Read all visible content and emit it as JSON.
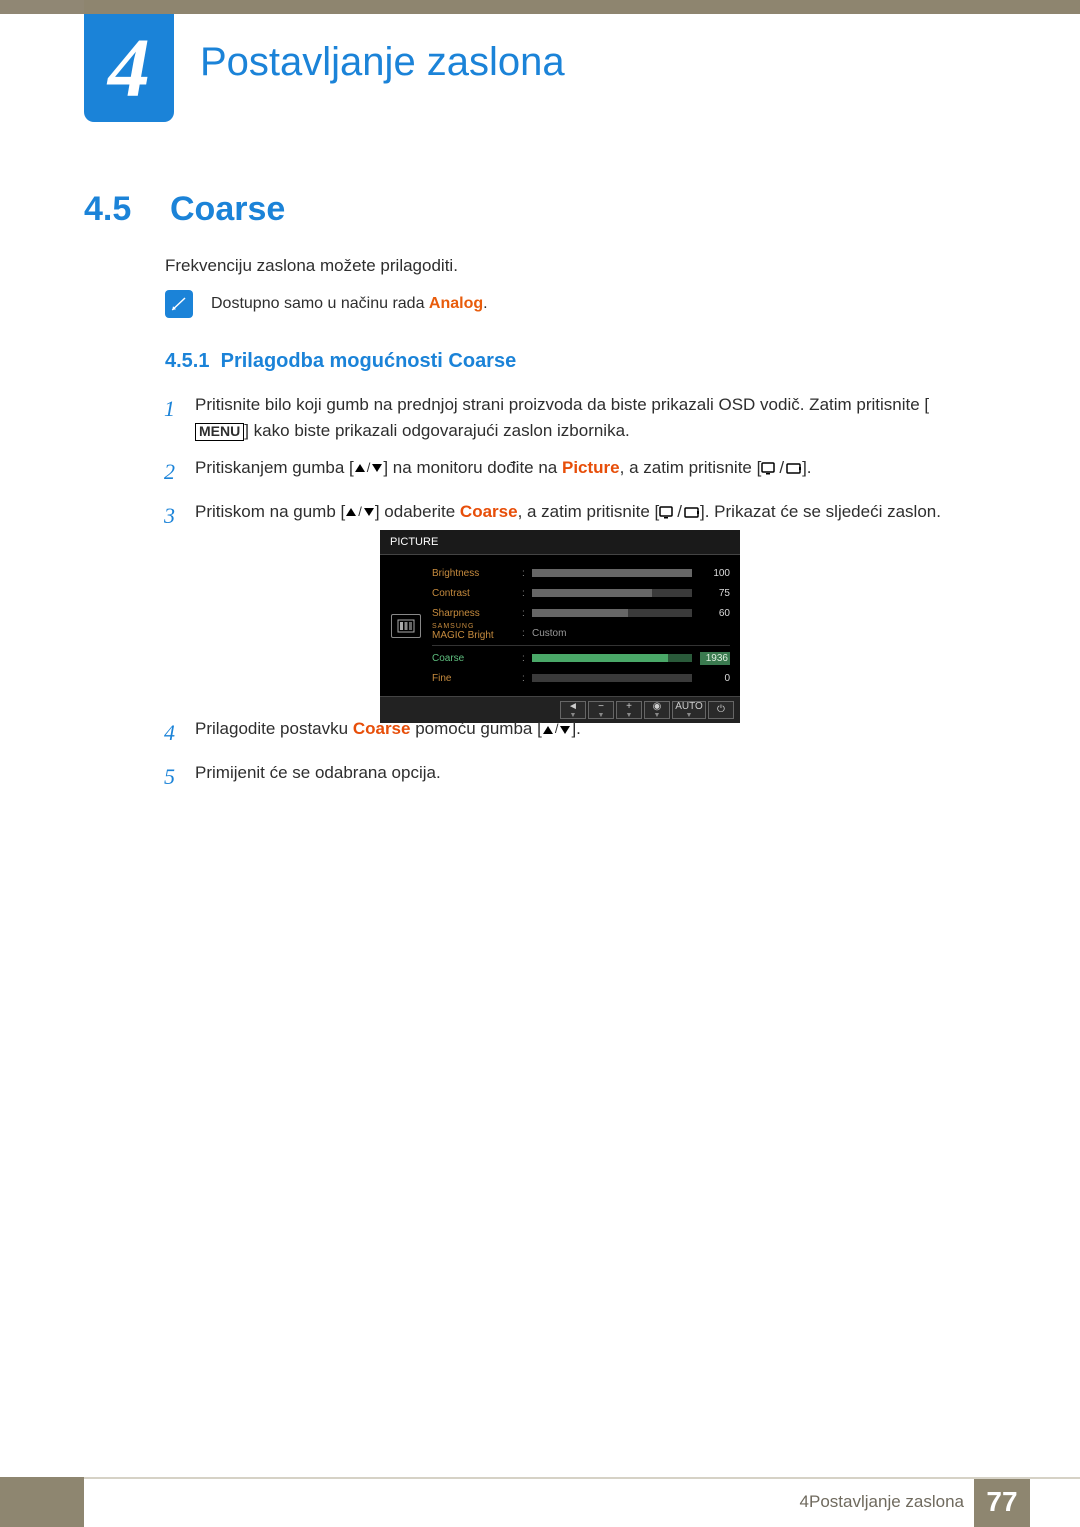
{
  "chapter": {
    "number": "4",
    "title": "Postavljanje zaslona"
  },
  "section": {
    "number": "4.5",
    "title": "Coarse"
  },
  "intro": "Frekvenciju zaslona možete prilagoditi.",
  "note": {
    "pre": "Dostupno samo u načinu rada ",
    "analog": "Analog",
    "post": "."
  },
  "subsection": {
    "number": "4.5.1",
    "title": "Prilagodba mogućnosti Coarse"
  },
  "steps": {
    "s1": {
      "num": "1",
      "a": "Pritisnite bilo koji gumb na prednjoj strani proizvoda da biste prikazali OSD vodič. Zatim pritisnite [",
      "menu": "MENU",
      "b": "] kako biste prikazali odgovarajući zaslon izbornika."
    },
    "s2": {
      "num": "2",
      "a": "Pritiskanjem gumba [",
      "b": "] na monitoru dođite na ",
      "picture": "Picture",
      "c": ", a zatim pritisnite [",
      "d": "]."
    },
    "s3": {
      "num": "3",
      "a": "Pritiskom na gumb [",
      "b": "] odaberite ",
      "coarse": "Coarse",
      "c": ", a zatim pritisnite [",
      "d": "]. Prikazat će se sljedeći zaslon."
    },
    "s4": {
      "num": "4",
      "a": "Prilagodite postavku ",
      "coarse": "Coarse",
      "b": " pomoću gumba [",
      "c": "]."
    },
    "s5": {
      "num": "5",
      "a": "Primijenit će se odabrana opcija."
    }
  },
  "osd": {
    "title": "PICTURE",
    "rows": {
      "brightness": {
        "label": "Brightness",
        "value": "100",
        "pct": 100
      },
      "contrast": {
        "label": "Contrast",
        "value": "75",
        "pct": 75
      },
      "sharpness": {
        "label": "Sharpness",
        "value": "60",
        "pct": 60
      },
      "magic": {
        "label_top": "SAMSUNG",
        "label": "MAGIC",
        "suffix": "Bright",
        "value": "Custom"
      },
      "coarse": {
        "label": "Coarse",
        "value": "1936",
        "pct": 85
      },
      "fine": {
        "label": "Fine",
        "value": "0",
        "pct": 0
      }
    },
    "nav": {
      "auto": "AUTO"
    }
  },
  "footer": {
    "text_prefix": "4 ",
    "text": "Postavljanje zaslona",
    "page": "77"
  }
}
